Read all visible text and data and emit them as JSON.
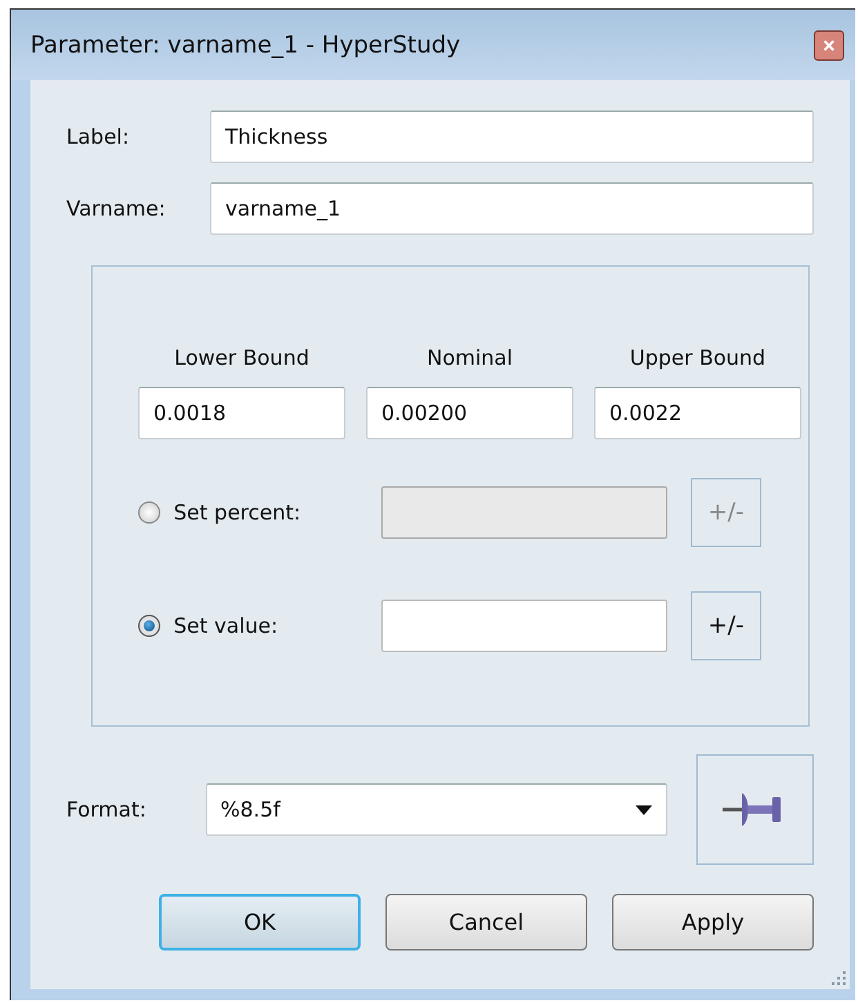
{
  "window": {
    "title": "Parameter: varname_1 - HyperStudy"
  },
  "fields": [
    {
      "label": "Label:",
      "value": "Thickness"
    },
    {
      "label": "Varname:",
      "value": "varname_1"
    }
  ],
  "bounds": [
    {
      "heading": "Lower Bound",
      "value": "0.0018"
    },
    {
      "heading": "Nominal",
      "value": "0.00200"
    },
    {
      "heading": "Upper Bound",
      "value": "0.0022"
    }
  ],
  "options": [
    {
      "label": "Set percent:",
      "selected": false,
      "disabled": true,
      "button": "+/-"
    },
    {
      "label": "Set value:",
      "selected": true,
      "disabled": false,
      "button": "+/-"
    }
  ],
  "format": {
    "label": "Format:",
    "value": "%8.5f"
  },
  "buttons": [
    {
      "label": "OK",
      "default": true
    },
    {
      "label": "Cancel",
      "default": false
    },
    {
      "label": "Apply",
      "default": false
    }
  ]
}
